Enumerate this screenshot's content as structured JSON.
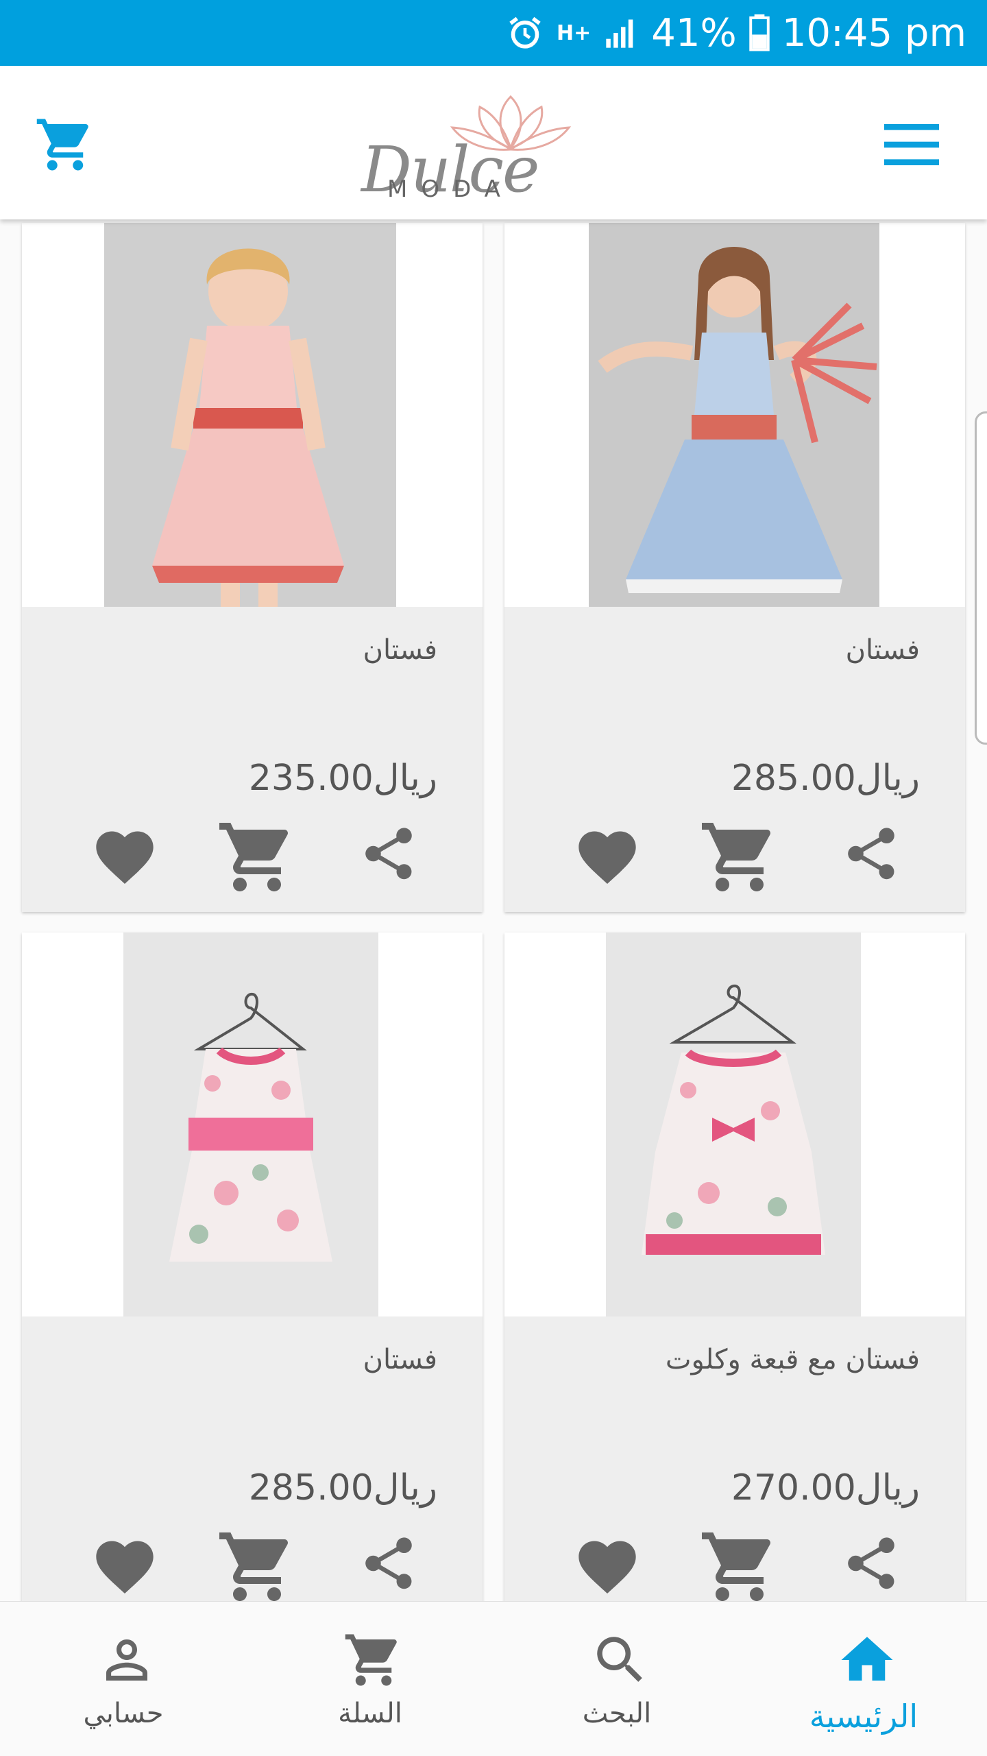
{
  "status_bar": {
    "alarm_icon": "alarm-clock-icon",
    "network": "H+",
    "battery": "41%",
    "time": "10:45 pm",
    "color": "#00a0de"
  },
  "header": {
    "logo_script": "Dulce",
    "logo_sub": "MODA",
    "cart_icon": "cart-icon",
    "menu_icon": "hamburger-menu-icon",
    "accent": "#0aa0dd"
  },
  "products": [
    {
      "title": "فستان",
      "price": "ريال285.00"
    },
    {
      "title": "فستان",
      "price": "ريال235.00"
    },
    {
      "title": "فستان مع قبعة وكلوت",
      "price": "ريال270.00"
    },
    {
      "title": "فستان",
      "price": "ريال285.00"
    }
  ],
  "card_actions": [
    "share-icon",
    "add-to-cart-icon",
    "favorite-heart-icon"
  ],
  "bottom_nav": [
    {
      "label": "الرئيسية",
      "icon": "home-icon",
      "active": true
    },
    {
      "label": "البحث",
      "icon": "search-icon",
      "active": false
    },
    {
      "label": "السلة",
      "icon": "cart-icon",
      "active": false
    },
    {
      "label": "حسابي",
      "icon": "account-icon",
      "active": false
    }
  ]
}
